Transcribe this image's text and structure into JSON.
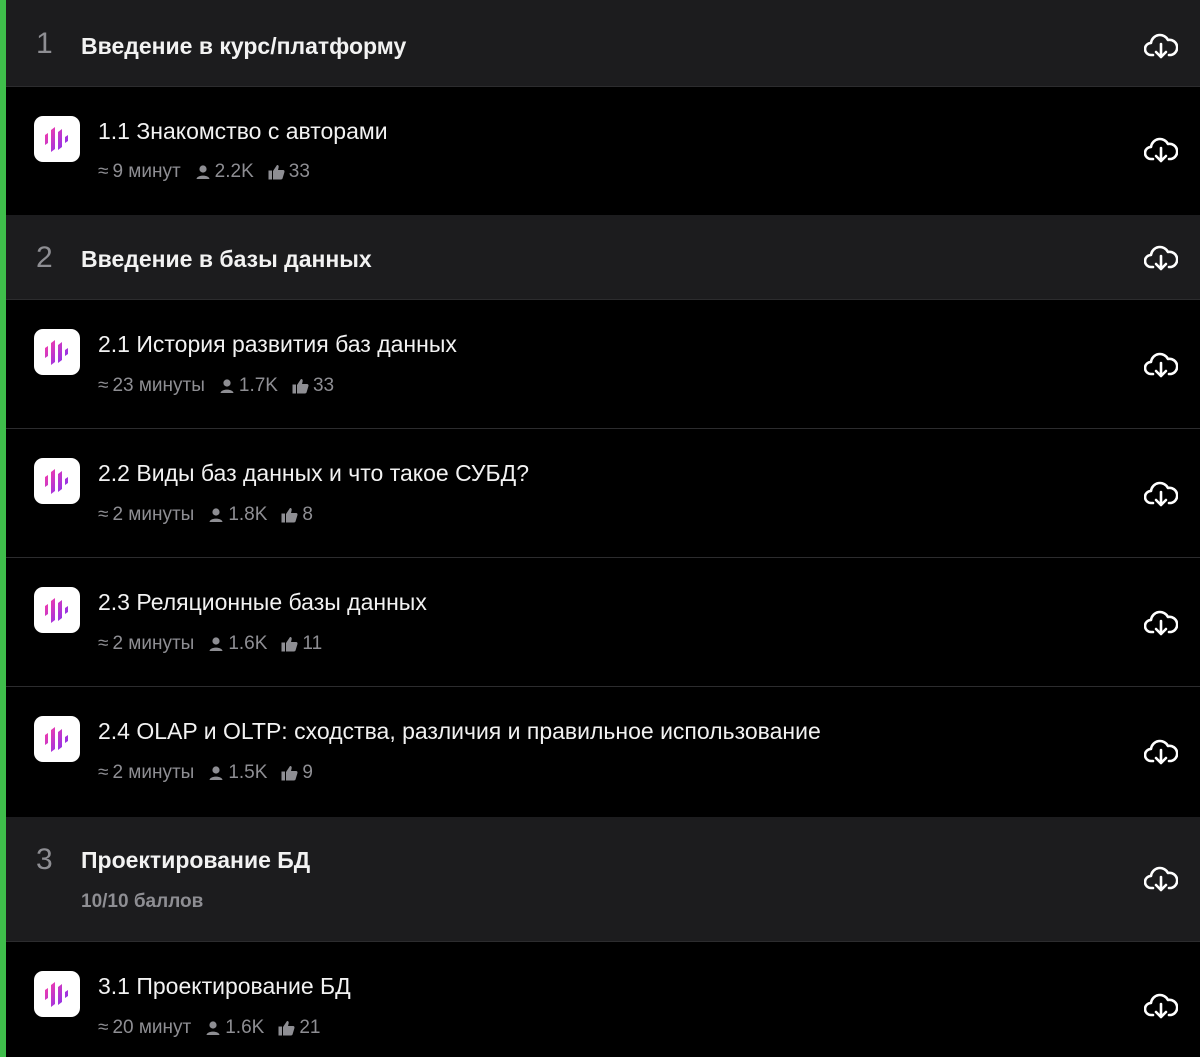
{
  "theme": {
    "accent": "#3fbe4b",
    "module_bg": "#1c1c1e",
    "lesson_bg": "#000000",
    "muted": "#8e8e93"
  },
  "icons": {
    "duration": "duration-icon",
    "learners": "person-icon",
    "likes": "thumbs-up-icon",
    "download": "cloud-download-icon",
    "lesson": "lesson-logo-icon"
  },
  "modules": [
    {
      "number": "1",
      "title": "Введение в курс/платформу",
      "lessons": [
        {
          "title": "1.1 Знакомство с авторами",
          "duration": "9 минут",
          "learners": "2.2K",
          "likes": "33"
        }
      ]
    },
    {
      "number": "2",
      "title": "Введение в базы данных",
      "lessons": [
        {
          "title": "2.1 История развития баз данных",
          "duration": "23 минуты",
          "learners": "1.7K",
          "likes": "33"
        },
        {
          "title": "2.2 Виды баз данных и что такое СУБД?",
          "duration": "2 минуты",
          "learners": "1.8K",
          "likes": "8"
        },
        {
          "title": "2.3 Реляционные базы данных",
          "duration": "2 минуты",
          "learners": "1.6K",
          "likes": "11"
        },
        {
          "title": "2.4 OLAP и OLTP: сходства, различия и правильное использование",
          "duration": "2 минуты",
          "learners": "1.5K",
          "likes": "9"
        }
      ]
    },
    {
      "number": "3",
      "title": "Проектирование БД",
      "score": "10/10 баллов",
      "lessons": [
        {
          "title": "3.1 Проектирование БД",
          "duration": "20 минут",
          "learners": "1.6K",
          "likes": "21"
        }
      ]
    }
  ]
}
